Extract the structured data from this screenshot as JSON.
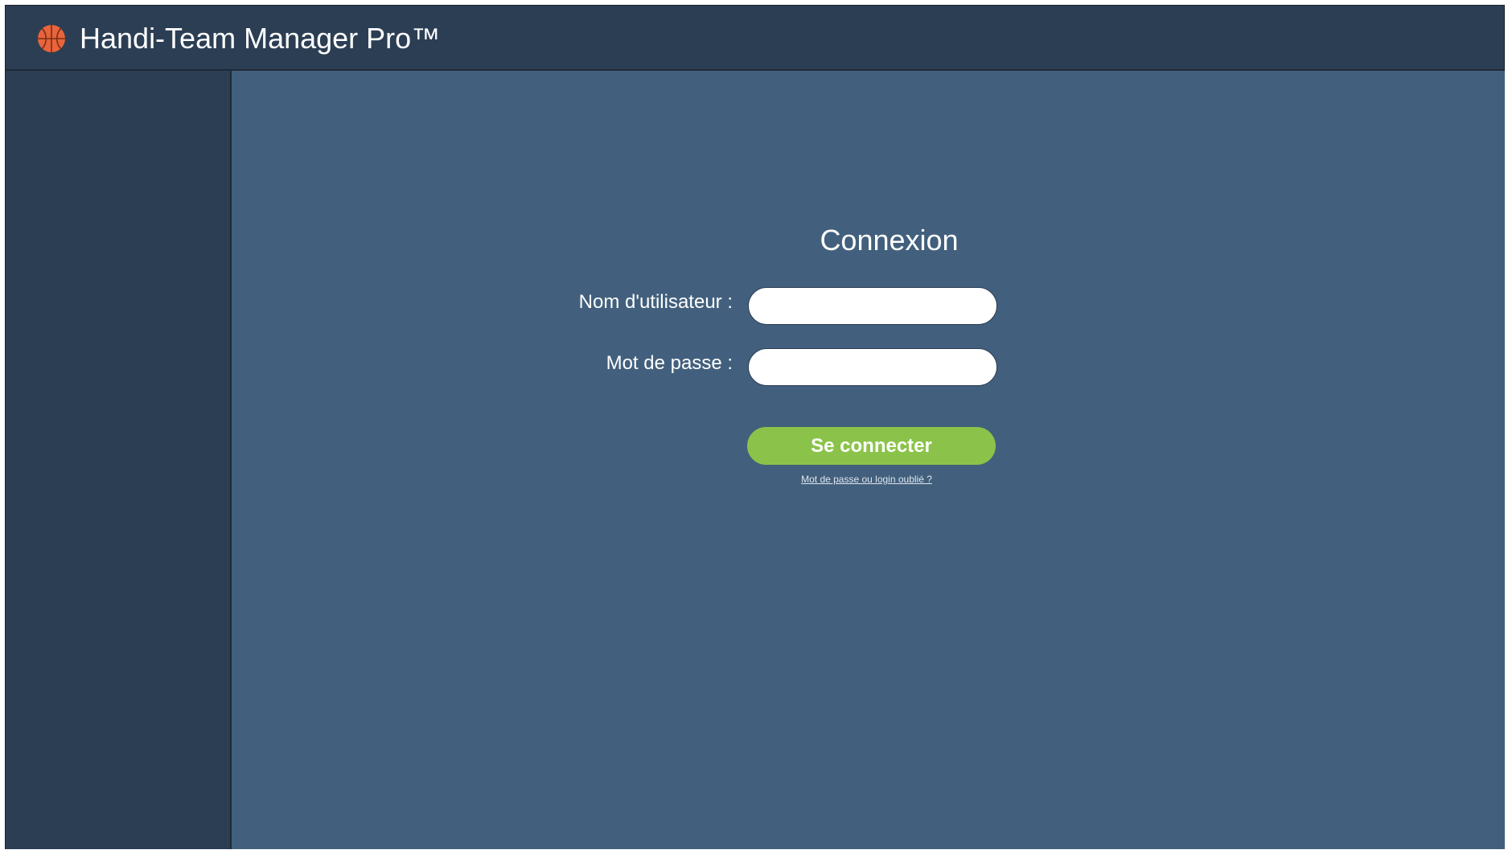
{
  "header": {
    "logo_icon": "basketball-icon",
    "app_title": "Handi-Team Manager Pro™"
  },
  "login": {
    "title": "Connexion",
    "username_label": "Nom d'utilisateur :",
    "username_value": "",
    "password_label": "Mot de passe :",
    "password_value": "",
    "submit_label": "Se connecter",
    "forgot_link": "Mot de passe ou login oublié ?"
  },
  "colors": {
    "header_bg": "#2c3e53",
    "sidebar_bg": "#2c3e53",
    "main_bg": "#42607d",
    "button_bg": "#8bc34a",
    "logo_orange": "#e8643c"
  }
}
